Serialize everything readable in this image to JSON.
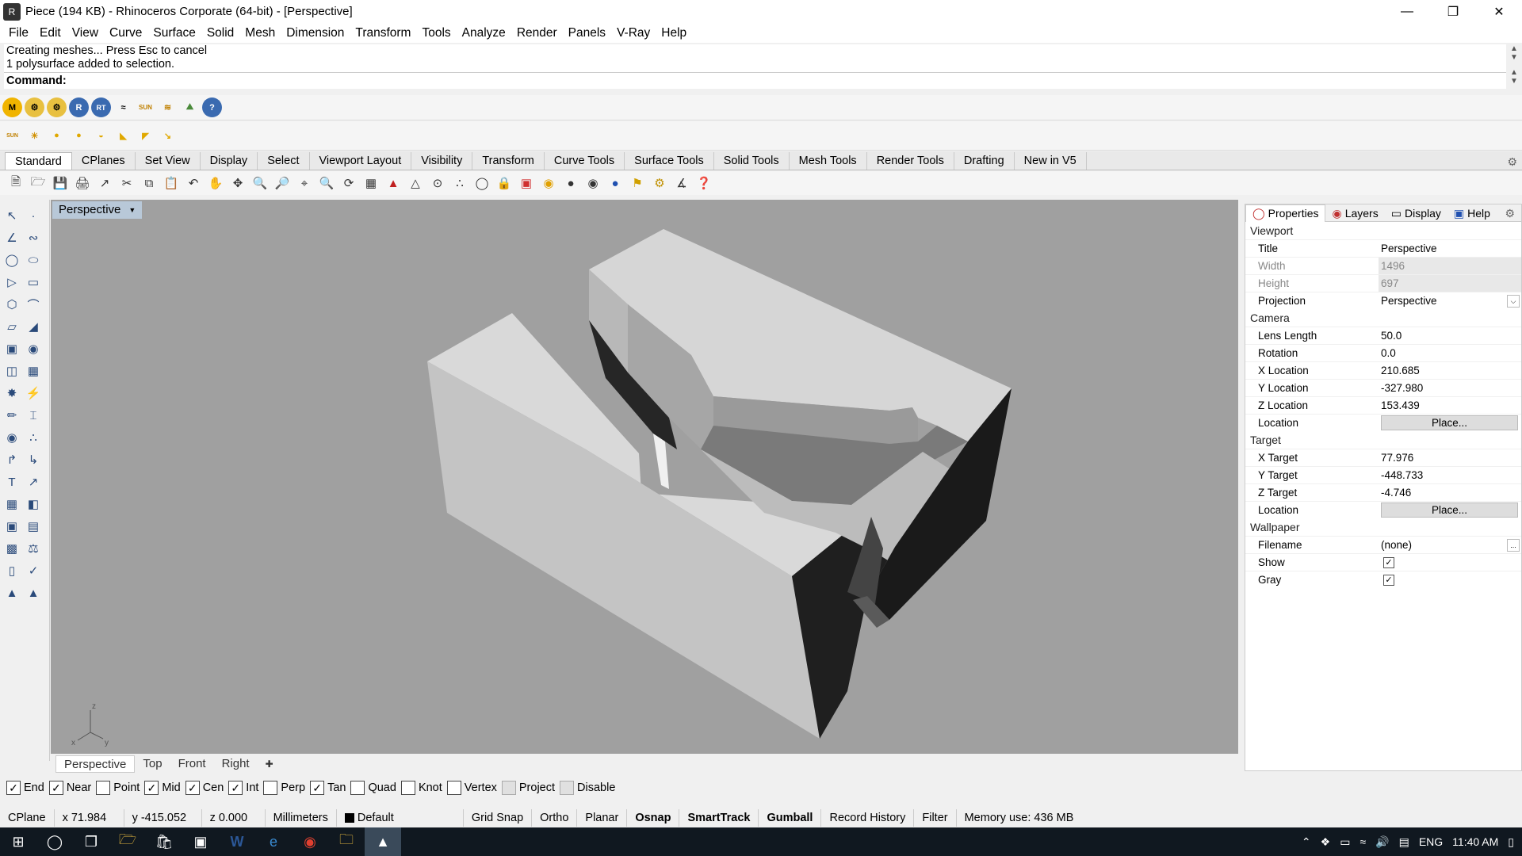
{
  "window": {
    "title": "Piece (194 KB) - Rhinoceros Corporate (64-bit) - [Perspective]",
    "icon": "rhino-icon"
  },
  "menu": [
    "File",
    "Edit",
    "View",
    "Curve",
    "Surface",
    "Solid",
    "Mesh",
    "Dimension",
    "Transform",
    "Tools",
    "Analyze",
    "Render",
    "Panels",
    "V-Ray",
    "Help"
  ],
  "command": {
    "history": [
      "Creating meshes... Press Esc to cancel",
      "1 polysurface added to selection."
    ],
    "prompt": "Command:"
  },
  "vray_toolbar": [
    "M",
    "⚙",
    "⚙",
    "R",
    "RT",
    "≈",
    "SUN",
    "≋",
    "⛰",
    "?"
  ],
  "light_toolbar": [
    "SUN",
    "☀",
    "●",
    "●",
    "◒",
    "◣",
    "◤",
    "↘"
  ],
  "tabs": [
    "Standard",
    "CPlanes",
    "Set View",
    "Display",
    "Select",
    "Viewport Layout",
    "Visibility",
    "Transform",
    "Curve Tools",
    "Surface Tools",
    "Solid Tools",
    "Mesh Tools",
    "Render Tools",
    "Drafting",
    "New in V5"
  ],
  "active_tab": "Standard",
  "viewport": {
    "label": "Perspective",
    "axes": {
      "z": "z",
      "x": "x",
      "y": "y"
    }
  },
  "viewport_tabs": [
    "Perspective",
    "Top",
    "Front",
    "Right"
  ],
  "active_viewport_tab": "Perspective",
  "panel_tabs": [
    "Properties",
    "Layers",
    "Display",
    "Help"
  ],
  "properties": {
    "viewport_section": "Viewport",
    "title_label": "Title",
    "title_value": "Perspective",
    "width_label": "Width",
    "width_value": "1496",
    "height_label": "Height",
    "height_value": "697",
    "projection_label": "Projection",
    "projection_value": "Perspective",
    "camera_section": "Camera",
    "lens_label": "Lens Length",
    "lens_value": "50.0",
    "rotation_label": "Rotation",
    "rotation_value": "0.0",
    "xloc_label": "X Location",
    "xloc_value": "210.685",
    "yloc_label": "Y Location",
    "yloc_value": "-327.980",
    "zloc_label": "Z Location",
    "zloc_value": "153.439",
    "location_label": "Location",
    "place_label": "Place...",
    "target_section": "Target",
    "xt_label": "X Target",
    "xt_value": "77.976",
    "yt_label": "Y Target",
    "yt_value": "-448.733",
    "zt_label": "Z Target",
    "zt_value": "-4.746",
    "tloc_label": "Location",
    "tplace_label": "Place...",
    "wallpaper_section": "Wallpaper",
    "filename_label": "Filename",
    "filename_value": "(none)",
    "browse_label": "...",
    "show_label": "Show",
    "gray_label": "Gray"
  },
  "osnaps": [
    {
      "label": "End",
      "checked": true
    },
    {
      "label": "Near",
      "checked": true
    },
    {
      "label": "Point",
      "checked": false
    },
    {
      "label": "Mid",
      "checked": true
    },
    {
      "label": "Cen",
      "checked": true
    },
    {
      "label": "Int",
      "checked": true
    },
    {
      "label": "Perp",
      "checked": false
    },
    {
      "label": "Tan",
      "checked": true
    },
    {
      "label": "Quad",
      "checked": false
    },
    {
      "label": "Knot",
      "checked": false
    },
    {
      "label": "Vertex",
      "checked": false
    },
    {
      "label": "Project",
      "checked": false
    },
    {
      "label": "Disable",
      "checked": false
    }
  ],
  "status": {
    "cplane": "CPlane",
    "x": "x 71.984",
    "y": "y -415.052",
    "z": "z 0.000",
    "units": "Millimeters",
    "layer": "Default",
    "grid_snap": "Grid Snap",
    "ortho": "Ortho",
    "planar": "Planar",
    "osnap": "Osnap",
    "smarttrack": "SmartTrack",
    "gumball": "Gumball",
    "record_history": "Record History",
    "filter": "Filter",
    "memory": "Memory use: 436 MB"
  },
  "taskbar": {
    "lang": "ENG",
    "time": "11:40 AM"
  }
}
